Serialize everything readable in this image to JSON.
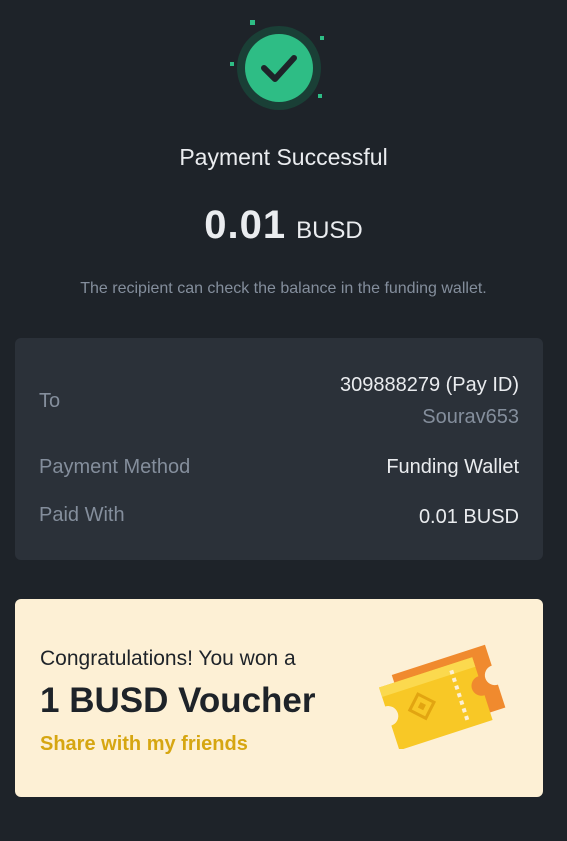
{
  "status": {
    "title": "Payment Successful",
    "amount": "0.01",
    "currency": "BUSD",
    "notice": "The recipient can check the balance in the funding wallet.",
    "icon": "check-circle-icon"
  },
  "details": {
    "to_label": "To",
    "to_value": "309888279 (Pay ID)",
    "to_sub": "Sourav653",
    "method_label": "Payment Method",
    "method_value": "Funding Wallet",
    "paid_label": "Paid With",
    "paid_value": "0.01 BUSD"
  },
  "voucher": {
    "congrats": "Congratulations! You won a",
    "title": "1 BUSD Voucher",
    "share": "Share with my friends",
    "icon": "voucher-ticket-icon"
  },
  "colors": {
    "background": "#1e2329",
    "card": "#2b3139",
    "success": "#2ebd85",
    "voucher_bg": "#fdf0d5",
    "accent": "#d6a611"
  }
}
